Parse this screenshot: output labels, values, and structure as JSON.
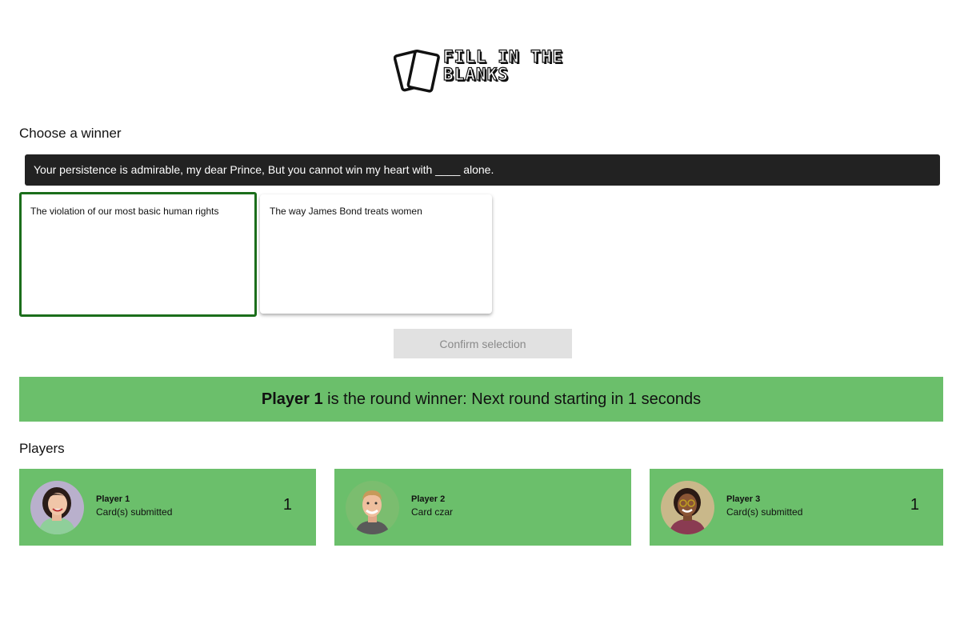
{
  "logo": {
    "line1": "FILL IN THE",
    "line2": "BLANKS"
  },
  "choose_winner_title": "Choose a winner",
  "prompt_card": {
    "text": "Your persistence is admirable, my dear Prince, But you cannot win my heart with ____ alone."
  },
  "answer_cards": [
    {
      "text": "The violation of our most basic human rights",
      "selected": true
    },
    {
      "text": "The way James Bond treats women",
      "selected": false
    }
  ],
  "confirm_button": {
    "label": "Confirm selection",
    "disabled": true
  },
  "round_winner": {
    "player": "Player 1",
    "message": " is the round winner: Next round starting in 1 seconds"
  },
  "players_title": "Players",
  "players": [
    {
      "name": "Player 1",
      "status": "Card(s) submitted",
      "score": "1",
      "avatar": "woman-avatar"
    },
    {
      "name": "Player 2",
      "status": "Card czar",
      "score": "",
      "avatar": "man-avatar"
    },
    {
      "name": "Player 3",
      "status": "Card(s) submitted",
      "score": "1",
      "avatar": "woman-glasses-avatar"
    }
  ],
  "colors": {
    "accent_green": "#6bbf6b",
    "selected_border": "#1b6e1b",
    "prompt_bg": "#222222",
    "button_disabled_bg": "#e1e1e1"
  }
}
